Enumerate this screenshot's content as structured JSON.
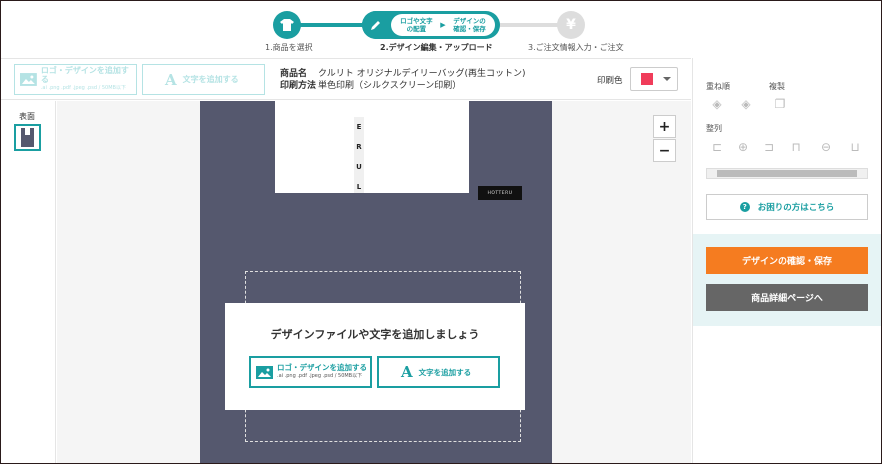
{
  "stepper": {
    "step1_label": "1.商品を選択",
    "step2_label": "2.デザイン編集・アップロード",
    "step2_sub1": "ロゴや文字の配置",
    "step2_sub2": "デザインの確認・保存",
    "step3_label": "3.ご注文情報入力・ご注文",
    "step3_icon": "¥"
  },
  "toolbar": {
    "add_logo_label": "ロゴ・デザインを追加する",
    "add_logo_sub": ".ai .png .pdf .jpeg .psd / 50MB以下",
    "add_text_label": "文字を追加する",
    "product_name_key": "商品名",
    "product_name_value": "クルリト オリジナルデイリーバッグ(再生コットン)",
    "print_method_key": "印刷方法",
    "print_method_value": "単色印刷（シルクスクリーン印刷）",
    "print_color_label": "印刷色",
    "print_color_hex": "#f03c5a"
  },
  "sidebar": {
    "side_label": "表面"
  },
  "canvas": {
    "zoom_in": "+",
    "zoom_out": "−",
    "bag_tag": "HOTTERU",
    "strap_letters": [
      "E",
      "R",
      "U",
      "L"
    ],
    "overlay_title": "デザインファイルや文字を追加しましょう",
    "overlay_logo_label": "ロゴ・デザインを追加する",
    "overlay_logo_sub": ".ai .png .pdf .jpeg .psd / 50MB以下",
    "overlay_text_label": "文字を追加する"
  },
  "right_panel": {
    "order_label": "重ね順",
    "duplicate_label": "複製",
    "align_label": "整列",
    "help_label": "お困りの方はこちら",
    "confirm_save_label": "デザインの確認・保存",
    "product_detail_label": "商品詳細ページへ"
  },
  "colors": {
    "accent": "#1a9ea1",
    "primary_button": "#f57c20",
    "secondary_button": "#666666",
    "bag": "#55586e"
  }
}
